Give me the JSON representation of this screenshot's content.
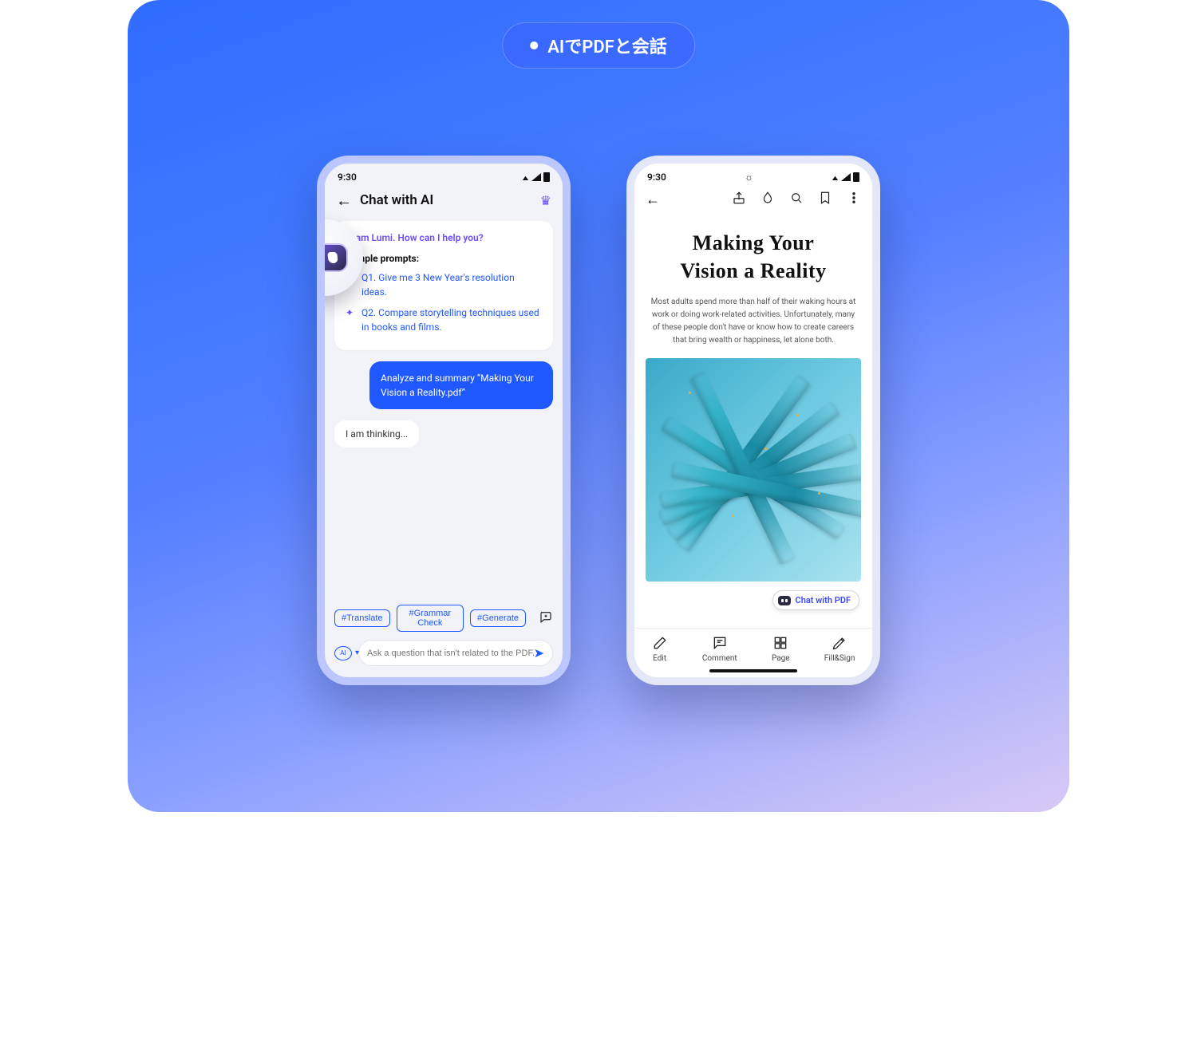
{
  "headerPill": "AIでPDFと会話",
  "statusTime": "9:30",
  "chat": {
    "title": "Chat with AI",
    "greeting": "! I am Lumi. How can I help you?",
    "samplesLabel": "Sample prompts:",
    "sample1": "Q1. Give me 3 New Year's resolution ideas.",
    "sample2": "Q2. Compare storytelling techniques used in books and films.",
    "userMsg": "Analyze and summary  “Making Your Vision a Reality.pdf”",
    "thinking": "I  am thinking...",
    "chip1": "#Translate",
    "chip2": "#Grammar Check",
    "chip3": "#Generate",
    "placeholder": "Ask a question that isn't related to the PDF.",
    "aiModeLabel": "AI"
  },
  "pdf": {
    "titleLine1": "Making Your",
    "titleLine2": "Vision a Reality",
    "body": "Most adults spend more than half of their waking hours at work or doing work-related activities. Unfortunately, many of these people don't have or know how to create careers that bring wealth or happiness, let alone both.",
    "chatBtn": "Chat with PDF",
    "nav": {
      "edit": "Edit",
      "comment": "Comment",
      "page": "Page",
      "fill": "Fill&Sign"
    }
  }
}
